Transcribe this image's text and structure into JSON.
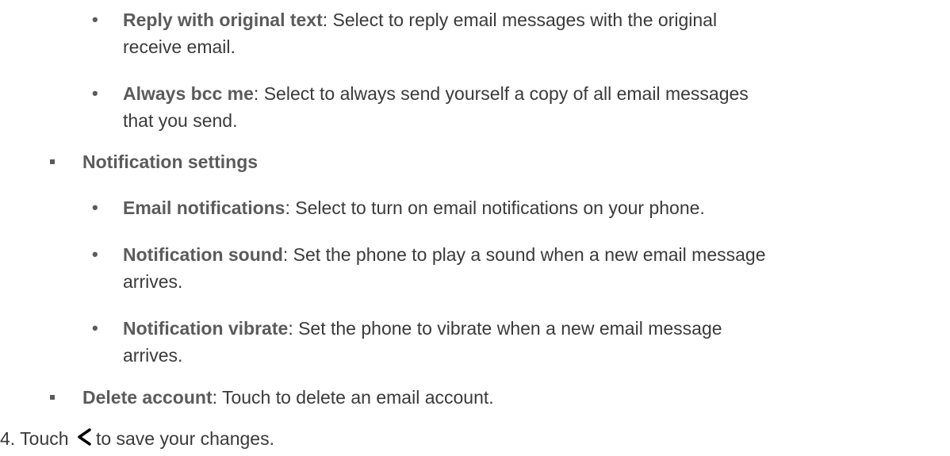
{
  "items": [
    {
      "term": "Reply with original text",
      "desc": ": Select to reply email messages with the original",
      "cont": "receive email."
    },
    {
      "term": "Always bcc me",
      "desc": ": Select to always send yourself a copy of all email messages",
      "cont": "that you send."
    },
    {
      "term": "Notification settings"
    },
    {
      "term": "Email notifications",
      "desc": ": Select to turn on email notifications on your phone."
    },
    {
      "term": "Notification sound",
      "desc": ": Set the phone to play a sound when a new email message",
      "cont": "arrives."
    },
    {
      "term": "Notification vibrate",
      "desc": ": Set the phone to vibrate when a new email message",
      "cont": "arrives."
    },
    {
      "term": "Delete account",
      "desc": ": Touch to delete an email account."
    }
  ],
  "step": {
    "number": "4.",
    "pre": "Touch",
    "icon": "back-chevron-icon",
    "post": "to save your changes."
  }
}
